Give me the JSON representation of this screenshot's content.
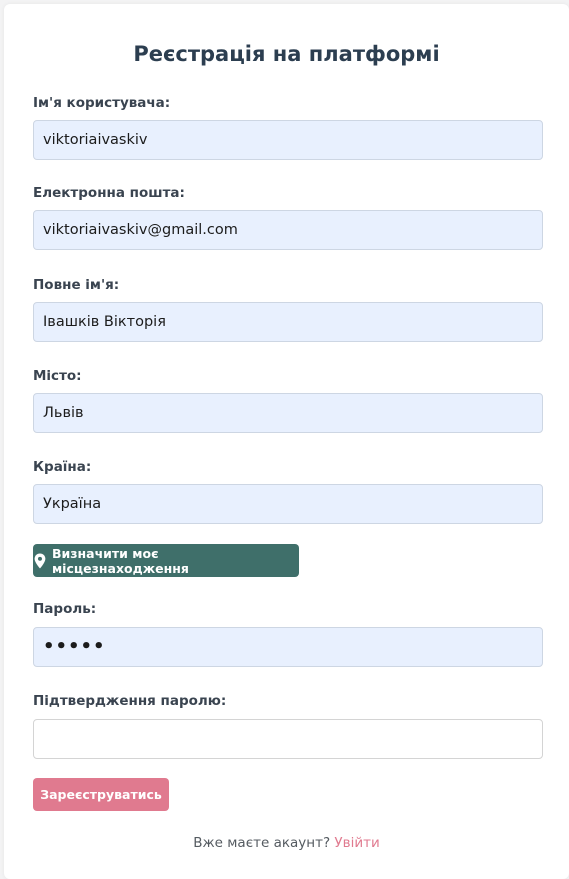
{
  "form": {
    "title": "Реєстрація на платформі",
    "fields": {
      "username": {
        "label": "Ім'я користувача:",
        "value": "viktoriaivaskiv"
      },
      "email": {
        "label": "Електронна пошта:",
        "value": "viktoriaivaskiv@gmail.com"
      },
      "full_name": {
        "label": "Повне ім'я:",
        "value": "Івашків Вікторія"
      },
      "city": {
        "label": "Місто:",
        "value": "Львів"
      },
      "country": {
        "label": "Країна:",
        "value": "Україна"
      },
      "password": {
        "label": "Пароль:",
        "value": "•••••"
      },
      "password_confirm": {
        "label": "Підтвердження паролю:",
        "value": ""
      }
    },
    "location_button": {
      "label": "Визначити моє місцезнаходження",
      "icon": "map-pin-icon"
    },
    "register_button": {
      "label": "Зареєструватись"
    },
    "footer": {
      "text": "Вже маєте акаунт?",
      "link": "Увійти"
    }
  },
  "colors": {
    "title": "#2c3e50",
    "autofill_bg": "#e8f0fe",
    "location_button": "#3f6f6a",
    "register_button": "#e07a8f",
    "link": "#e07a8f"
  }
}
